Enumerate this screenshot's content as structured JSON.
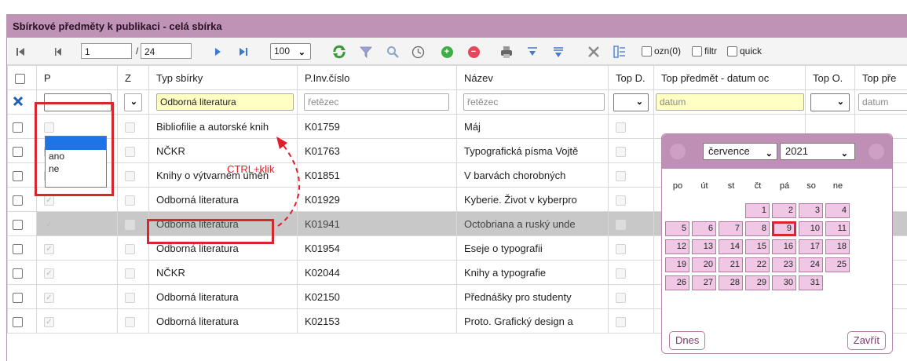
{
  "title": "Sbírkové předměty k publikaci - celá sbírka",
  "toolbar": {
    "page_current": "1",
    "page_sep": "/",
    "page_total": "24",
    "page_size": "100",
    "ozn_label": "ozn(0)",
    "filtr_label": "filtr",
    "quick_label": "quick"
  },
  "columns": [
    "P",
    "Z",
    "Typ sbírky",
    "P.Inv.číslo",
    "Název",
    "Top D.",
    "Top předmět - datum oc",
    "Top O.",
    "Top pře"
  ],
  "filters": {
    "typ": "Odborná literatura",
    "inv_placeholder": "řetězec",
    "nazev_placeholder": "řetězec",
    "datum_placeholder": "datum",
    "datum2_placeholder": "datum"
  },
  "dropdown_options": [
    "ano",
    "ne"
  ],
  "annotation": "CTRL+klik",
  "rows": [
    {
      "typ": "Bibliofilie a autorské knih",
      "inv": "K01759",
      "nazev": "Máj"
    },
    {
      "typ": "NČKR",
      "inv": "K01763",
      "nazev": "Typografická písma Vojtě"
    },
    {
      "typ": "Knihy o výtvarném uměn",
      "inv": "K01851",
      "nazev": "V barvách chorobných"
    },
    {
      "typ": "Odborná literatura",
      "inv": "K01929",
      "nazev": "Kyberie. Život v kyberpro"
    },
    {
      "typ": "Odborná literatura",
      "inv": "K01941",
      "nazev": "Octobriana a ruský unde"
    },
    {
      "typ": "Odborná literatura",
      "inv": "K01954",
      "nazev": "Eseje o typografii"
    },
    {
      "typ": "NČKR",
      "inv": "K02044",
      "nazev": "Knihy a typografie"
    },
    {
      "typ": "Odborná literatura",
      "inv": "K02150",
      "nazev": "Přednášky pro studenty"
    },
    {
      "typ": "Odborná literatura",
      "inv": "K02153",
      "nazev": "Proto. Grafický design a"
    }
  ],
  "calendar": {
    "month": "července",
    "year": "2021",
    "weekdays": [
      "po",
      "út",
      "st",
      "čt",
      "pá",
      "so",
      "ne"
    ],
    "days": [
      "1",
      "2",
      "3",
      "4",
      "5",
      "6",
      "7",
      "8",
      "9",
      "10",
      "11",
      "12",
      "13",
      "14",
      "15",
      "16",
      "17",
      "18",
      "19",
      "20",
      "21",
      "22",
      "23",
      "24",
      "25",
      "26",
      "27",
      "28",
      "29",
      "30",
      "31"
    ],
    "today_label": "Dnes",
    "close_label": "Zavřít"
  },
  "colors": {
    "header": "#bf93b6",
    "accent_red": "#d6262f",
    "calendar_day": "#f0c8e6"
  }
}
